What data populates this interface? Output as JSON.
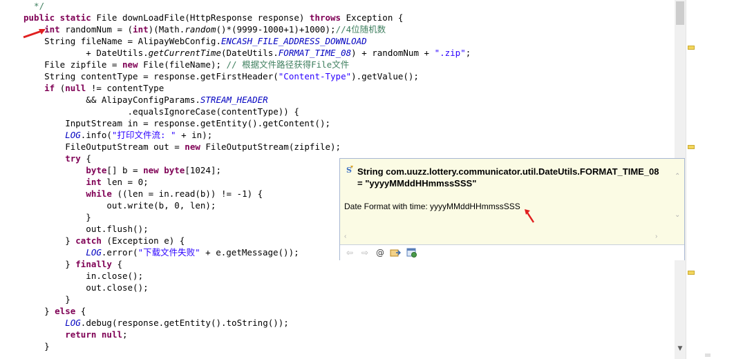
{
  "editor": {
    "lines": [
      [
        {
          "t": "  */",
          "c": "cm"
        }
      ],
      [
        {
          "t": "public static ",
          "c": "kw"
        },
        {
          "t": "File downLoadFile(HttpResponse response) ",
          "c": "plain"
        },
        {
          "t": "throws ",
          "c": "kw"
        },
        {
          "t": "Exception {",
          "c": "plain"
        }
      ],
      [
        {
          "t": "    ",
          "c": "plain"
        },
        {
          "t": "int ",
          "c": "kw"
        },
        {
          "t": "randomNum = (",
          "c": "plain"
        },
        {
          "t": "int",
          "c": "kw"
        },
        {
          "t": ")(Math.",
          "c": "plain"
        },
        {
          "t": "random",
          "c": "method"
        },
        {
          "t": "()*(9999-1000+1)+1000);",
          "c": "plain"
        },
        {
          "t": "//4位随机数",
          "c": "cm"
        }
      ],
      [
        {
          "t": "    String fileName = AlipayWebConfig.",
          "c": "plain"
        },
        {
          "t": "ENCASH_FILE_ADDRESS_DOWNLOAD",
          "c": "field"
        }
      ],
      [
        {
          "t": "            + DateUtils.",
          "c": "plain"
        },
        {
          "t": "getCurrentTime",
          "c": "method"
        },
        {
          "t": "(DateUtils.",
          "c": "plain"
        },
        {
          "t": "FORMAT_TIME_08",
          "c": "field"
        },
        {
          "t": ") + randomNum + ",
          "c": "plain"
        },
        {
          "t": "\".zip\"",
          "c": "str"
        },
        {
          "t": ";",
          "c": "plain"
        }
      ],
      [
        {
          "t": "    File zipfile = ",
          "c": "plain"
        },
        {
          "t": "new ",
          "c": "kw"
        },
        {
          "t": "File(fileName); ",
          "c": "plain"
        },
        {
          "t": "// 根据文件路径获得File文件",
          "c": "cm"
        }
      ],
      [
        {
          "t": "    String contentType = response.getFirstHeader(",
          "c": "plain"
        },
        {
          "t": "\"Content-Type\"",
          "c": "str"
        },
        {
          "t": ").getValue();",
          "c": "plain"
        }
      ],
      [
        {
          "t": "    ",
          "c": "plain"
        },
        {
          "t": "if ",
          "c": "kw"
        },
        {
          "t": "(",
          "c": "plain"
        },
        {
          "t": "null ",
          "c": "kw"
        },
        {
          "t": "!= contentType",
          "c": "plain"
        }
      ],
      [
        {
          "t": "            && AlipayConfigParams.",
          "c": "plain"
        },
        {
          "t": "STREAM_HEADER",
          "c": "field"
        }
      ],
      [
        {
          "t": "                    .equalsIgnoreCase(contentType)) {",
          "c": "plain"
        }
      ],
      [
        {
          "t": "        InputStream in = response.getEntity().getContent();",
          "c": "plain"
        }
      ],
      [
        {
          "t": "        ",
          "c": "plain"
        },
        {
          "t": "LOG",
          "c": "field"
        },
        {
          "t": ".info(",
          "c": "plain"
        },
        {
          "t": "\"打印文件流: \"",
          "c": "str"
        },
        {
          "t": " + in);",
          "c": "plain"
        }
      ],
      [
        {
          "t": "        FileOutputStream out = ",
          "c": "plain"
        },
        {
          "t": "new ",
          "c": "kw"
        },
        {
          "t": "FileOutputStream(zipfile);",
          "c": "plain"
        }
      ],
      [
        {
          "t": "        ",
          "c": "plain"
        },
        {
          "t": "try ",
          "c": "kw"
        },
        {
          "t": "{",
          "c": "plain"
        }
      ],
      [
        {
          "t": "            ",
          "c": "plain"
        },
        {
          "t": "byte",
          "c": "kw"
        },
        {
          "t": "[] b = ",
          "c": "plain"
        },
        {
          "t": "new ",
          "c": "kw"
        },
        {
          "t": "byte",
          "c": "kw"
        },
        {
          "t": "[1024];",
          "c": "plain"
        }
      ],
      [
        {
          "t": "            ",
          "c": "plain"
        },
        {
          "t": "int ",
          "c": "kw"
        },
        {
          "t": "len = 0;",
          "c": "plain"
        }
      ],
      [
        {
          "t": "            ",
          "c": "plain"
        },
        {
          "t": "while ",
          "c": "kw"
        },
        {
          "t": "((len = in.read(b)) != -1) {",
          "c": "plain"
        }
      ],
      [
        {
          "t": "                out.write(b, 0, len);",
          "c": "plain"
        }
      ],
      [
        {
          "t": "            }",
          "c": "plain"
        }
      ],
      [
        {
          "t": "            out.flush();",
          "c": "plain"
        }
      ],
      [
        {
          "t": "        } ",
          "c": "plain"
        },
        {
          "t": "catch ",
          "c": "kw"
        },
        {
          "t": "(Exception e) {",
          "c": "plain"
        }
      ],
      [
        {
          "t": "            ",
          "c": "plain"
        },
        {
          "t": "LOG",
          "c": "field"
        },
        {
          "t": ".error(",
          "c": "plain"
        },
        {
          "t": "\"下载文件失败\"",
          "c": "str"
        },
        {
          "t": " + e.getMessage());",
          "c": "plain"
        }
      ],
      [
        {
          "t": "        } ",
          "c": "plain"
        },
        {
          "t": "finally ",
          "c": "kw"
        },
        {
          "t": "{",
          "c": "plain"
        }
      ],
      [
        {
          "t": "            in.close();",
          "c": "plain"
        }
      ],
      [
        {
          "t": "            out.close();",
          "c": "plain"
        }
      ],
      [
        {
          "t": "        }",
          "c": "plain"
        }
      ],
      [
        {
          "t": "    } ",
          "c": "plain"
        },
        {
          "t": "else ",
          "c": "kw"
        },
        {
          "t": "{",
          "c": "plain"
        }
      ],
      [
        {
          "t": "        ",
          "c": "plain"
        },
        {
          "t": "LOG",
          "c": "field"
        },
        {
          "t": ".debug(response.getEntity().toString());",
          "c": "plain"
        }
      ],
      [
        {
          "t": "        ",
          "c": "plain"
        },
        {
          "t": "return null",
          "c": "kw"
        },
        {
          "t": ";",
          "c": "plain"
        }
      ],
      [
        {
          "t": "    }",
          "c": "plain"
        }
      ]
    ]
  },
  "hover": {
    "title_line1": "String com.uuzz.lottery.communicator.util.DateUtils.FORMAT_TIME_08",
    "title_line2": "= \"yyyyMMddHHmmssSSS\"",
    "body": "Date Format with time: yyyyMMddHHmmssSSS",
    "toolbar": {
      "back_icon": "back-arrow-icon",
      "forward_icon": "forward-arrow-icon",
      "javadoc_icon": "at-javadoc-icon",
      "open_declaration_icon": "open-declaration-icon",
      "open_attached_javadoc_icon": "open-external-javadoc-icon"
    }
  },
  "colors": {
    "keyword": "#7f0055",
    "string": "#2a00ff",
    "comment": "#3f7f5f",
    "field": "#0000c0",
    "annotation_arrow": "#e02020",
    "hover_bg": "#fbfbe4"
  }
}
